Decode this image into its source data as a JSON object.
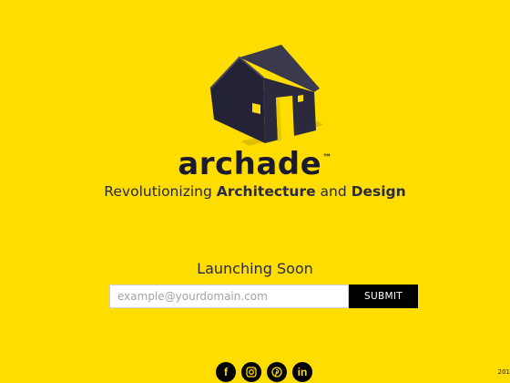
{
  "brand": {
    "name": "archade",
    "trademark": "™",
    "logo_icon": "house-icon"
  },
  "tagline": {
    "part1": "Revolutionizing ",
    "bold1": "Architecture",
    "part2": " and ",
    "bold2": "Design"
  },
  "launch": {
    "heading": "Launching Soon",
    "email_placeholder": "example@yourdomain.com",
    "email_value": "",
    "submit_label": "SUBMIT"
  },
  "social": [
    {
      "name": "facebook-icon",
      "glyph": "f"
    },
    {
      "name": "instagram-icon",
      "glyph": ""
    },
    {
      "name": "pinterest-icon",
      "glyph": ""
    },
    {
      "name": "linkedin-icon",
      "glyph": "in"
    }
  ],
  "footer": {
    "year_text": "201"
  },
  "colors": {
    "background": "#ffdd00",
    "text": "#1b1a2e",
    "button": "#000000",
    "logo_dark": "#2b2a3d"
  }
}
